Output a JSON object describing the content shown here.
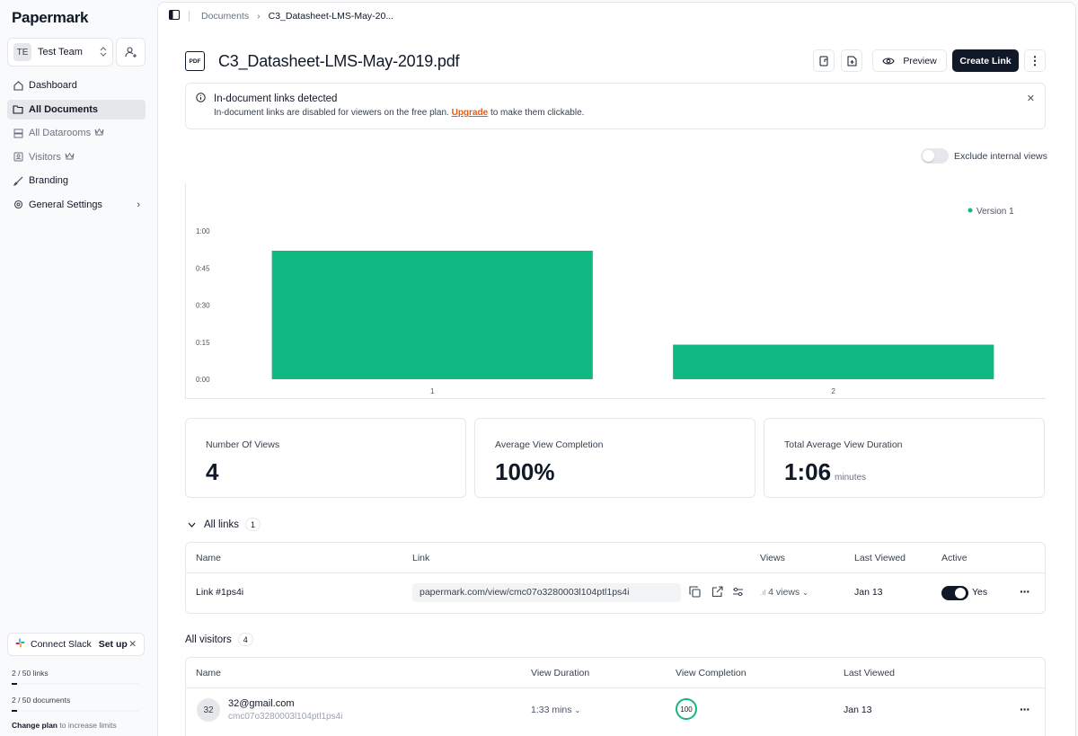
{
  "sidebar": {
    "logo": "Papermark",
    "team": {
      "initials": "TE",
      "name": "Test Team"
    },
    "nav": [
      {
        "label": "Dashboard",
        "icon": "home-icon"
      },
      {
        "label": "All Documents",
        "icon": "folder-icon",
        "active": true
      },
      {
        "label": "All Datarooms",
        "icon": "server-icon",
        "muted": true,
        "crown": true
      },
      {
        "label": "Visitors",
        "icon": "contact-icon",
        "muted": true,
        "crown": true
      },
      {
        "label": "Branding",
        "icon": "brush-icon"
      },
      {
        "label": "General Settings",
        "icon": "cog-icon",
        "chevron": true
      }
    ],
    "slack": {
      "label": "Connect Slack",
      "action": "Set up"
    },
    "limits": [
      {
        "label": "2 / 50 links",
        "fraction": 0.04
      },
      {
        "label": "2 / 50 documents",
        "fraction": 0.04
      }
    ],
    "change_plan": {
      "action": "Change plan",
      "text": "to increase limits"
    }
  },
  "breadcrumb": {
    "root": "Documents",
    "current": "C3_Datasheet-LMS-May-20..."
  },
  "document": {
    "type_badge": "PDF",
    "title": "C3_Datasheet-LMS-May-2019.pdf",
    "preview_label": "Preview",
    "create_link_label": "Create Link"
  },
  "notice": {
    "title": "In-document links detected",
    "text_before": "In-document links are disabled for viewers on the free plan.",
    "link": "Upgrade",
    "text_after": "to make them clickable."
  },
  "exclude_toggle": {
    "label": "Exclude internal views",
    "on": false
  },
  "chart_data": {
    "type": "bar",
    "categories": [
      "1",
      "2"
    ],
    "series": [
      {
        "name": "Version 1",
        "values": [
          52,
          14
        ],
        "color": "#10b981"
      }
    ],
    "y_ticks": [
      "0:00",
      "0:15",
      "0:30",
      "0:45",
      "1:00"
    ],
    "ylim": [
      0,
      60
    ],
    "y_unit": "seconds",
    "legend_position": "top-right"
  },
  "stats": [
    {
      "label": "Number Of Views",
      "value": "4",
      "unit": ""
    },
    {
      "label": "Average View Completion",
      "value": "100%",
      "unit": ""
    },
    {
      "label": "Total Average View Duration",
      "value": "1:06",
      "unit": "minutes"
    }
  ],
  "links_section": {
    "title": "All links",
    "count": "1",
    "columns": [
      "Name",
      "Link",
      "Views",
      "Last Viewed",
      "Active"
    ],
    "rows": [
      {
        "name": "Link #1ps4i",
        "url": "papermark.com/view/cmc07o3280003l104ptl1ps4i",
        "views": "4 views",
        "last_viewed": "Jan 13",
        "active_label": "Yes",
        "active": true
      }
    ]
  },
  "visitors_section": {
    "title": "All visitors",
    "count": "4",
    "columns": [
      "Name",
      "View Duration",
      "View Completion",
      "Last Viewed"
    ],
    "rows": [
      {
        "avatar": "32",
        "email": "32@gmail.com",
        "link_id": "cmc07o3280003l104ptl1ps4i",
        "duration": "1:33 mins",
        "completion": "100",
        "last_viewed": "Jan 13"
      }
    ]
  }
}
